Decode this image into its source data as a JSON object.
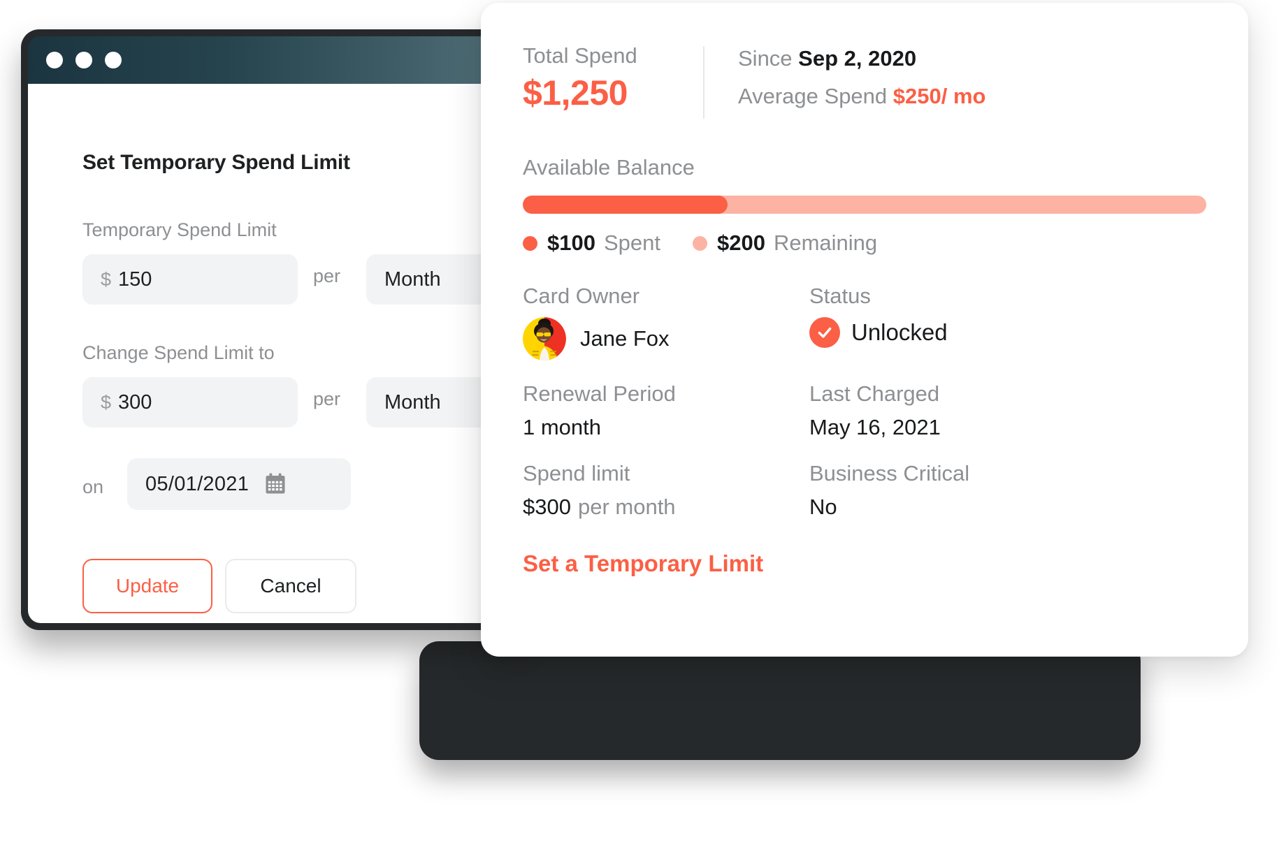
{
  "back_window": {
    "titlebar": {
      "dots": [
        "close-dot",
        "minimize-dot",
        "maximize-dot"
      ]
    },
    "form": {
      "title": "Set Temporary Spend Limit",
      "temp_limit_label": "Temporary Spend Limit",
      "temp_limit_currency": "$",
      "temp_limit_value": "150",
      "temp_limit_per": "per",
      "temp_limit_period": "Month",
      "change_limit_label": "Change Spend Limit to",
      "change_limit_currency": "$",
      "change_limit_value": "300",
      "change_limit_per": "per",
      "change_limit_period": "Month",
      "date_prefix": "on",
      "date_value": "05/01/2021",
      "update_button": "Update",
      "cancel_button": "Cancel"
    }
  },
  "front_card": {
    "summary": {
      "total_spend_label": "Total Spend",
      "total_spend_value": "$1,250",
      "since_label": "Since",
      "since_value": "Sep 2, 2020",
      "average_label": "Average Spend",
      "average_value": "$250/ mo"
    },
    "balance": {
      "label": "Available Balance",
      "percent_spent": 30,
      "spent_value": "$100",
      "spent_label": "Spent",
      "remaining_value": "$200",
      "remaining_label": "Remaining"
    },
    "details": [
      {
        "left_title": "Card Owner",
        "left_value": "Jane Fox",
        "right_title": "Status",
        "right_value": "Unlocked"
      },
      {
        "left_title": "Renewal Period",
        "left_value": "1 month",
        "right_title": "Last Charged",
        "right_value": "May 16, 2021"
      },
      {
        "left_title": "Spend limit",
        "left_value": "$300",
        "left_value_suffix": "per month",
        "right_title": "Business Critical",
        "right_value": "No"
      }
    ],
    "temp_limit_link": "Set a Temporary Limit"
  },
  "colors": {
    "accent": "#fb5f45",
    "accent_light": "#fcb3a4",
    "muted_text": "#8d8f92",
    "dark_text": "#17191b",
    "field_bg": "#f2f3f4",
    "window_frame": "#26292b",
    "titlebar_from": "#1b3540",
    "titlebar_to": "#55727b"
  }
}
